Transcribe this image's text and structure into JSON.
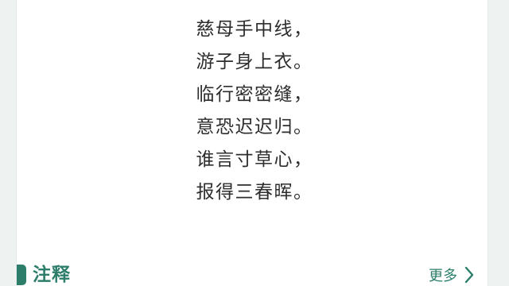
{
  "poem": {
    "lines": [
      "慈母手中线，",
      "游子身上衣。",
      "临行密密缝，",
      "意恐迟迟归。",
      "谁言寸草心，",
      "报得三春晖。"
    ]
  },
  "annotation_section": {
    "title": "注释",
    "more_label": "更多",
    "more_icon": "chevron-right-icon"
  },
  "colors": {
    "accent": "#2c7e6a",
    "background": "#eef3f1",
    "card": "#ffffff",
    "text": "#2d2d2d"
  }
}
